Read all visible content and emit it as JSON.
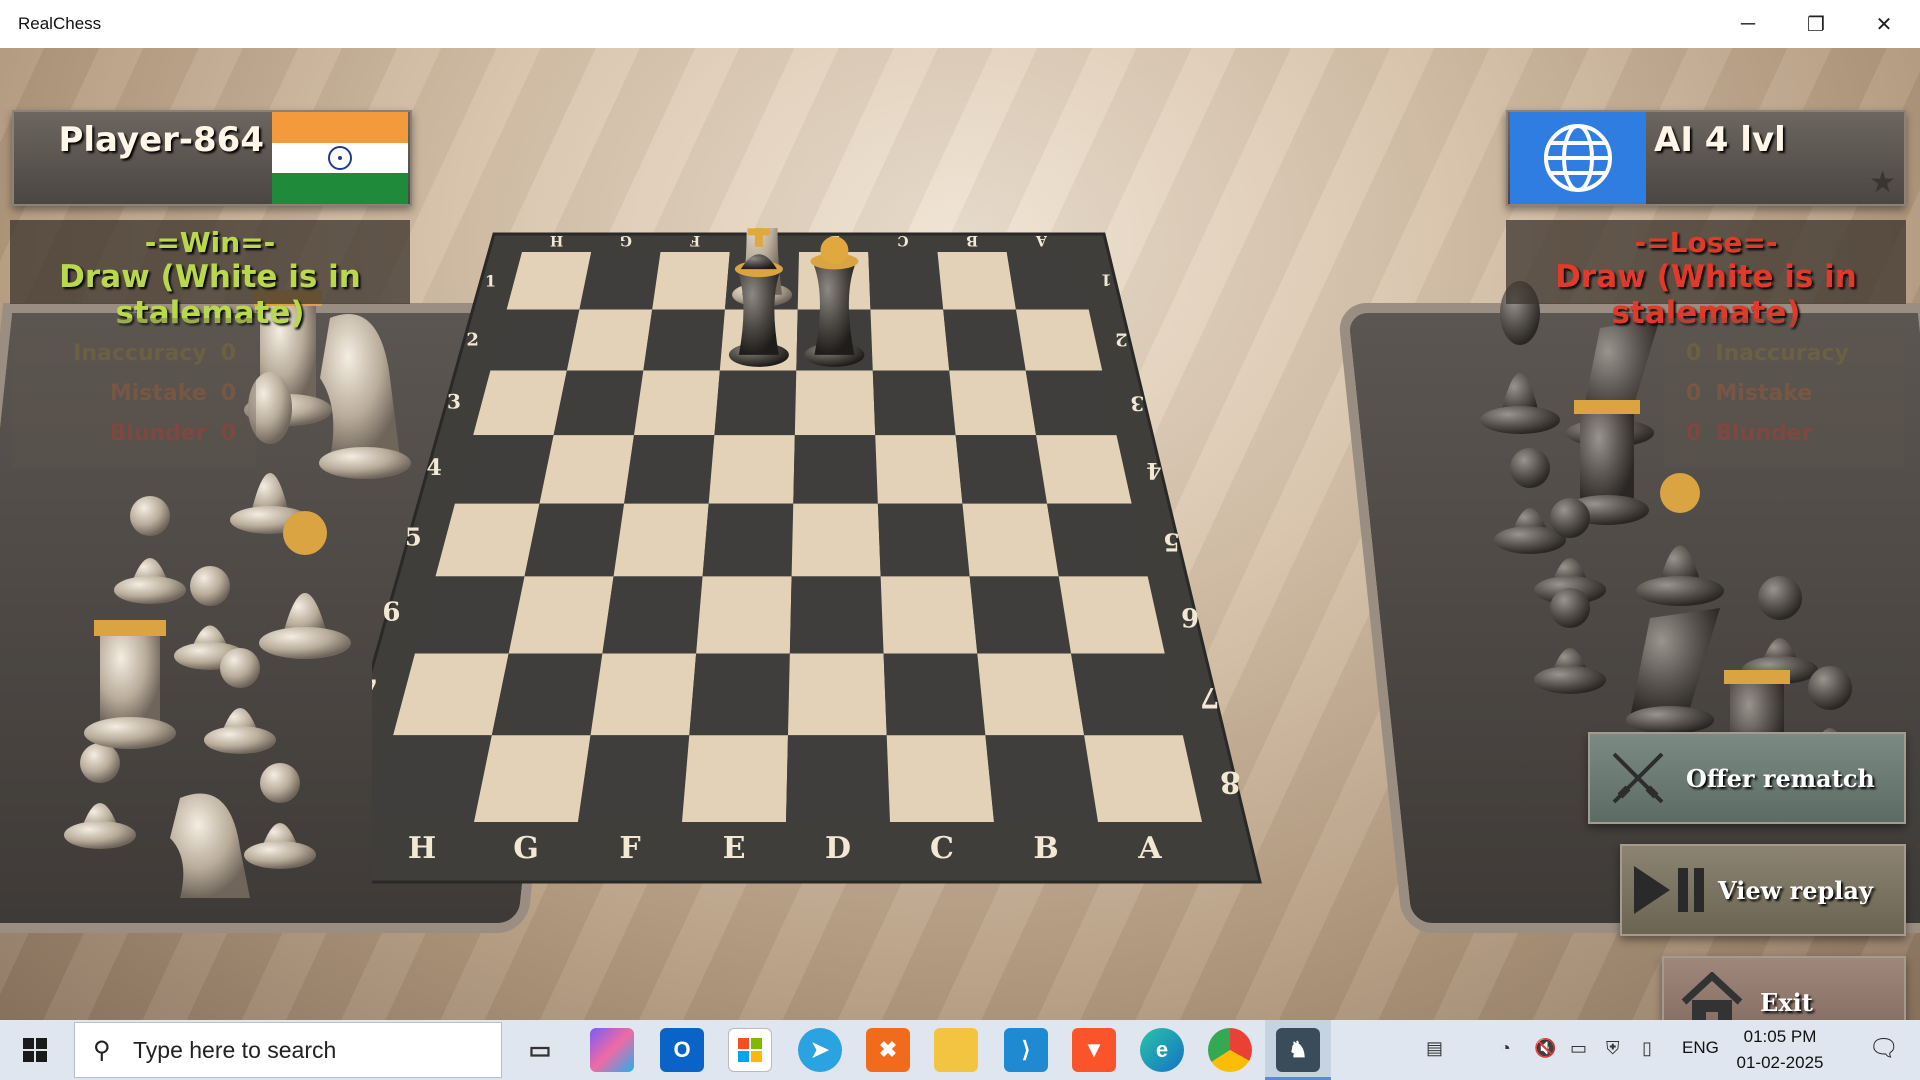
{
  "window": {
    "title": "RealChess",
    "minimize_label": "─",
    "maximize_label": "❐",
    "close_label": "✕"
  },
  "players": {
    "left": {
      "name": "Player-864",
      "flag": "india-flag",
      "result_title": "-=Win=-",
      "result_detail": "Draw (White is in stalemate)",
      "stats": [
        {
          "label": "Inaccuracy",
          "count": "0"
        },
        {
          "label": "Mistake",
          "count": "0"
        },
        {
          "label": "Blunder",
          "count": "0"
        }
      ]
    },
    "right": {
      "name": "AI 4 lvl",
      "flag": "globe-icon",
      "result_title": "-=Lose=-",
      "result_detail": "Draw (White is in stalemate)",
      "stats": [
        {
          "label": "Inaccuracy",
          "count": "0"
        },
        {
          "label": "Mistake",
          "count": "0"
        },
        {
          "label": "Blunder",
          "count": "0"
        }
      ]
    }
  },
  "board": {
    "top_files": [
      "H",
      "G",
      "F",
      "E",
      "D",
      "C",
      "B",
      "A"
    ],
    "bottom_files": [
      "H",
      "G",
      "F",
      "E",
      "D",
      "C",
      "B",
      "A"
    ],
    "ranks": [
      "1",
      "2",
      "3",
      "4",
      "5",
      "6",
      "7",
      "8"
    ],
    "pieces": [
      {
        "piece": "king",
        "color": "white",
        "square": "E1"
      },
      {
        "piece": "king",
        "color": "black",
        "square": "E2"
      },
      {
        "piece": "queen",
        "color": "black",
        "square": "D2"
      }
    ]
  },
  "buttons": {
    "rematch": "Offer rematch",
    "replay": "View replay",
    "exit": "Exit"
  },
  "taskbar": {
    "search_placeholder": "Type here to search",
    "language": "ENG",
    "time": "01:05 PM",
    "date": "01-02-2025"
  },
  "colors": {
    "win": "#b9d94a",
    "lose": "#e23a2a",
    "light_square": "#e3d2b7",
    "dark_square": "#3f3e3c"
  }
}
